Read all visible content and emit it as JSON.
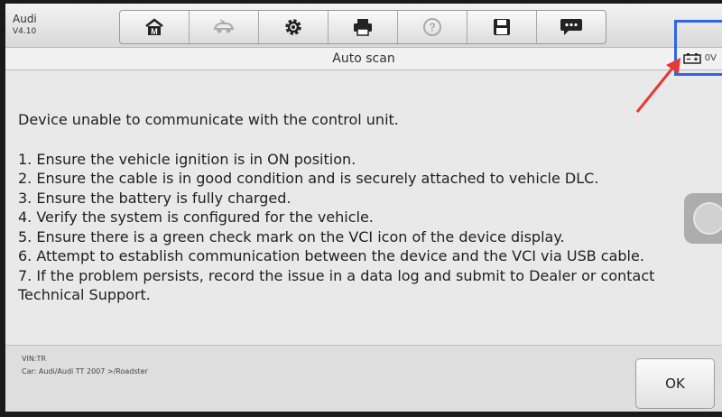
{
  "vehicle": {
    "make": "Audi",
    "version": "V4.10"
  },
  "toolbar": {
    "buttons": [
      {
        "icon": "home-icon"
      },
      {
        "icon": "vehicle-swap-icon"
      },
      {
        "icon": "settings-gear-icon"
      },
      {
        "icon": "print-icon"
      },
      {
        "icon": "help-icon"
      },
      {
        "icon": "save-icon"
      },
      {
        "icon": "data-log-icon"
      }
    ]
  },
  "title": "Auto scan",
  "battery": {
    "voltage": "0V"
  },
  "message": {
    "heading": "Device unable to communicate with the control unit.",
    "items": [
      "1. Ensure the vehicle ignition is in ON position.",
      "2. Ensure the cable is in good condition and is securely attached to vehicle DLC.",
      "3. Ensure the battery is fully charged.",
      "4. Verify the system is configured for the vehicle.",
      "5. Ensure there is a green check mark on the VCI icon of the device display.",
      "6. Attempt to establish communication between the device and the VCI via USB cable.",
      "7. If the problem persists, record the issue in a data log and submit to Dealer or contact Technical Support."
    ]
  },
  "footer": {
    "vin": "VIN:TR",
    "car": "Car: Audi/Audi TT 2007 >/Roadster",
    "ok_label": "OK"
  },
  "colors": {
    "highlight": "#2f64e6",
    "arrow": "#e53935"
  }
}
